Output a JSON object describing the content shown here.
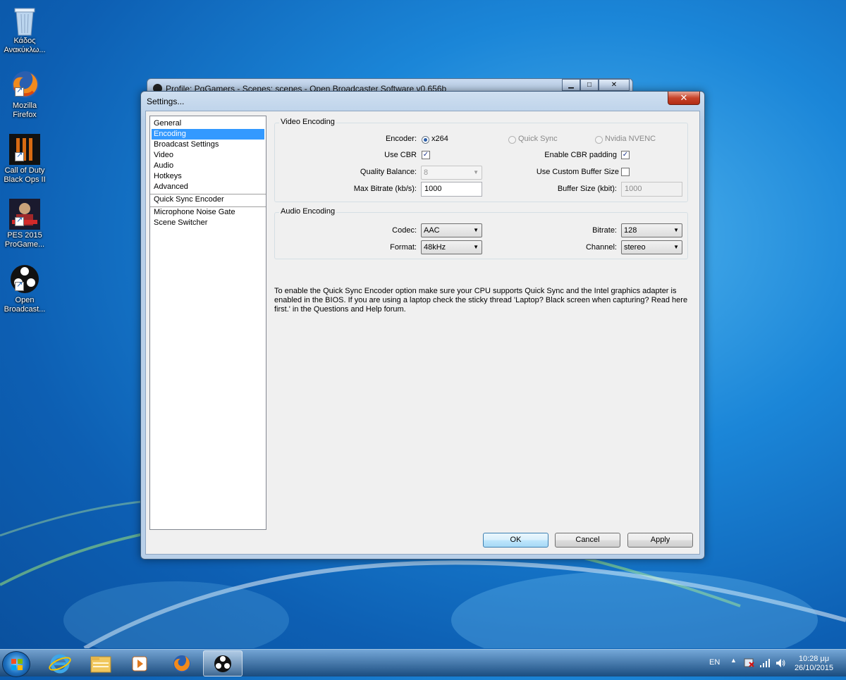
{
  "desktop": {
    "icons": [
      {
        "name": "recycle-bin",
        "label": "Κάδος Ανακύκλω..."
      },
      {
        "name": "firefox",
        "label": "Mozilla Firefox"
      },
      {
        "name": "call-of-duty",
        "label": "Call of Duty Black Ops II"
      },
      {
        "name": "pes-2015",
        "label": "PES 2015 ProGame..."
      },
      {
        "name": "obs",
        "label": "Open Broadcast..."
      }
    ]
  },
  "background_window": {
    "title": "Profile: PgGamers - Scenes: scenes - Open Broadcaster Software v0.656b",
    "min_label": "▁",
    "max_label": "□",
    "close_label": "✕"
  },
  "dialog": {
    "title": "Settings...",
    "close_label": "✕",
    "categories": [
      "General",
      "Encoding",
      "Broadcast Settings",
      "Video",
      "Audio",
      "Hotkeys",
      "Advanced",
      "Quick Sync Encoder",
      "Microphone Noise Gate",
      "Scene Switcher"
    ],
    "selected_category": "Encoding",
    "video_encoding": {
      "group_title": "Video Encoding",
      "encoder_label": "Encoder:",
      "encoder_options": [
        "x264",
        "Quick Sync",
        "Nvidia NVENC"
      ],
      "encoder_selected": "x264",
      "use_cbr_label": "Use CBR",
      "use_cbr_checked": true,
      "enable_cbr_padding_label": "Enable CBR padding",
      "enable_cbr_padding_checked": true,
      "quality_balance_label": "Quality Balance:",
      "quality_balance_value": "8",
      "use_custom_buffer_label": "Use Custom Buffer Size",
      "use_custom_buffer_checked": false,
      "max_bitrate_label": "Max Bitrate (kb/s):",
      "max_bitrate_value": "1000",
      "buffer_size_label": "Buffer Size (kbit):",
      "buffer_size_value": "1000"
    },
    "audio_encoding": {
      "group_title": "Audio Encoding",
      "codec_label": "Codec:",
      "codec_value": "AAC",
      "bitrate_label": "Bitrate:",
      "bitrate_value": "128",
      "format_label": "Format:",
      "format_value": "48kHz",
      "channel_label": "Channel:",
      "channel_value": "stereo"
    },
    "note": "To enable the Quick Sync Encoder option make sure your CPU supports Quick Sync and the Intel graphics adapter is enabled in the BIOS. If you are using a laptop check the sticky thread 'Laptop? Black screen when capturing? Read here first.' in the Questions and Help forum.",
    "buttons": {
      "ok": "OK",
      "cancel": "Cancel",
      "apply": "Apply"
    }
  },
  "taskbar": {
    "items": [
      "start-orb",
      "internet-explorer",
      "windows-explorer",
      "media-player",
      "firefox",
      "obs"
    ],
    "active_item": "obs",
    "language": "EN",
    "time": "10:28 μμ",
    "date": "26/10/2015"
  },
  "colors": {
    "selection": "#3399ff",
    "desktop_blue": "#1b86d8",
    "dialog_bg": "#f0f0f0"
  }
}
